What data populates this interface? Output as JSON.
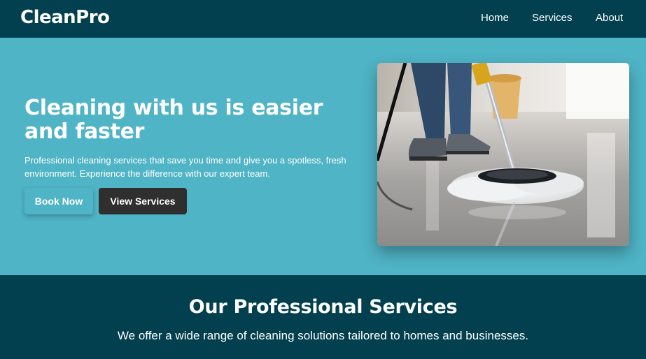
{
  "navbar": {
    "brand": "CleanPro",
    "links": [
      "Home",
      "Services",
      "About"
    ]
  },
  "hero": {
    "title": "Cleaning with us is easier and faster",
    "description": "Professional cleaning services that save you time and give you a spotless, fresh environment. Experience the difference with our expert team.",
    "book_button": "Book Now",
    "view_button": "View Services",
    "image_subject": "person mopping a glossy floor"
  },
  "services": {
    "title": "Our Professional Services",
    "subtitle": "We offer a wide range of cleaning solutions tailored to homes and businesses."
  },
  "colors": {
    "navbar_bg": "#02404f",
    "hero_bg": "#4fb4c6",
    "dark_button": "#2f2f2f",
    "text": "#ffffff"
  }
}
